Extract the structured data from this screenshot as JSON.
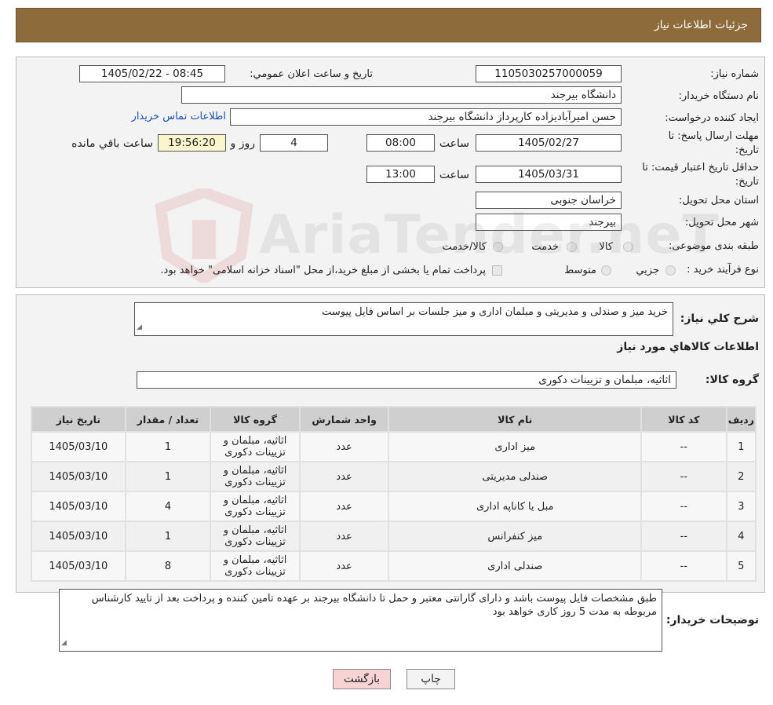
{
  "header": {
    "title": "جزئیات اطلاعات نیاز"
  },
  "form": {
    "need_number_label": "شماره نیاز:",
    "need_number": "1105030257000059",
    "announce_label": "تاریخ و ساعت اعلان عمومي:",
    "announce_value": "1405/02/22 - 08:45",
    "buyer_org_label": "نام دستگاه خریدار:",
    "buyer_org": "دانشگاه بیرجند",
    "creator_label": "ایجاد کننده درخواست:",
    "creator": "حسن امیرآبادیزاده کارپرداز دانشگاه بیرجند",
    "contact_link": "اطلاعات تماس خریدار",
    "deadline_label_1": "مهلت ارسال پاسخ: تا",
    "deadline_label_2": "تاریخ:",
    "deadline_date": "1405/02/27",
    "time_label": "ساعت",
    "deadline_time": "08:00",
    "days_value": "4",
    "days_label": "روز و",
    "remaining_time": "19:56:20",
    "remaining_label": "ساعت باقي مانده",
    "validity_label_1": "حداقل تاریخ اعتبار قیمت: تا",
    "validity_label_2": "تاریخ:",
    "validity_date": "1405/03/31",
    "validity_time": "13:00",
    "province_label": "استان محل تحویل:",
    "province": "خراسان جنوبی",
    "city_label": "شهر محل تحویل:",
    "city": "بیرجند",
    "category_label": "طبقه بندی موضوعی:",
    "category_options": [
      "کالا",
      "خدمت",
      "کالا/خدمت"
    ],
    "process_label": "نوع فرآیند خرید :",
    "process_options": [
      "جزیي",
      "متوسط"
    ],
    "payment_note": "پرداخت تمام یا بخشی از مبلغ خرید،از محل \"اسناد خزانه اسلامی\" خواهد بود."
  },
  "details": {
    "summary_label": "شرح کلي نیاز:",
    "summary": "خرید میز و صندلی و مدیریتی و مبلمان اداری و میز جلسات بر اساس فایل پیوست",
    "goods_info_title": "اطلاعات کالاهاي مورد نیاز",
    "goods_group_label": "گروه کالا:",
    "goods_group": "اثاثیه، مبلمان و تزیینات دکوری"
  },
  "table": {
    "headers": [
      "ردیف",
      "کد کالا",
      "نام کالا",
      "واحد شمارش",
      "گروه کالا",
      "تعداد / مقدار",
      "تاریخ نیاز"
    ],
    "rows": [
      [
        "1",
        "--",
        "میز اداری",
        "عدد",
        "اثاثیه، مبلمان و تزیینات دکوری",
        "1",
        "1405/03/10"
      ],
      [
        "2",
        "--",
        "صندلی مدیریتی",
        "عدد",
        "اثاثیه، مبلمان و تزیینات دکوری",
        "1",
        "1405/03/10"
      ],
      [
        "3",
        "--",
        "مبل یا کاناپه اداری",
        "عدد",
        "اثاثیه، مبلمان و تزیینات دکوری",
        "4",
        "1405/03/10"
      ],
      [
        "4",
        "--",
        "میز کنفرانس",
        "عدد",
        "اثاثیه، مبلمان و تزیینات دکوری",
        "1",
        "1405/03/10"
      ],
      [
        "5",
        "--",
        "صندلی اداری",
        "عدد",
        "اثاثیه، مبلمان و تزیینات دکوری",
        "8",
        "1405/03/10"
      ]
    ]
  },
  "notes": {
    "label": "توضیحات خریدار:",
    "text": "طبق مشخصات فایل پیوست باشد و دارای گارانتی معتبر و حمل تا دانشگاه بیرجند بر عهده تامین کننده  و پرداخت بعد از تایید کارشناس مربوطه به مدت 5 روز کاری خواهد بود"
  },
  "buttons": {
    "print": "چاپ",
    "back": "بازگشت"
  },
  "watermark_text": "AriaTender.neT",
  "colors": {
    "header": "#8d6b3b",
    "back_button": "#f8d3d3",
    "print_button": "#f3f3f3",
    "link": "#1a4fb4",
    "watermark": "#c0392b"
  }
}
